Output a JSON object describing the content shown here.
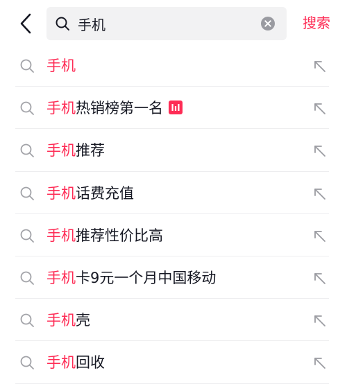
{
  "header": {
    "back_icon": "chevron-left-icon",
    "search_icon": "search-icon",
    "query": "手机",
    "clear_icon": "clear-circle-icon",
    "search_button": "搜索"
  },
  "suggestions": [
    {
      "highlight": "手机",
      "rest": "",
      "badge": null
    },
    {
      "highlight": "手机",
      "rest": "热销榜第一名",
      "badge": "chart-bars-icon"
    },
    {
      "highlight": "手机",
      "rest": "推荐",
      "badge": null
    },
    {
      "highlight": "手机",
      "rest": "话费充值",
      "badge": null
    },
    {
      "highlight": "手机",
      "rest": "推荐性价比高",
      "badge": null
    },
    {
      "highlight": "手机",
      "rest": "卡9元一个月中国移动",
      "badge": null
    },
    {
      "highlight": "手机",
      "rest": "壳",
      "badge": null
    },
    {
      "highlight": "手机",
      "rest": "回收",
      "badge": null
    }
  ],
  "colors": {
    "accent": "#fe2c55",
    "text": "#161823",
    "icon_gray": "#9a9ba1",
    "search_bg": "#f2f2f3"
  }
}
